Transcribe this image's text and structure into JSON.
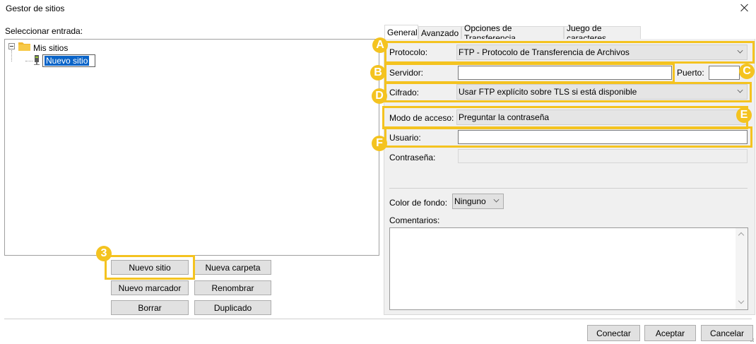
{
  "window": {
    "title": "Gestor de sitios"
  },
  "left": {
    "select_label": "Seleccionar entrada:",
    "tree": {
      "root": "Mis sitios",
      "child_editing": "Nuevo sitio"
    },
    "buttons": {
      "new_site": "Nuevo sitio",
      "new_folder": "Nueva carpeta",
      "new_bookmark": "Nuevo marcador",
      "rename": "Renombrar",
      "delete": "Borrar",
      "duplicate": "Duplicado"
    }
  },
  "tabs": [
    "General",
    "Avanzado",
    "Opciones de Transferencia",
    "Juego de caracteres"
  ],
  "general": {
    "protocol_label": "Protocolo:",
    "protocol_value": "FTP - Protocolo de Transferencia de Archivos",
    "server_label": "Servidor:",
    "server_value": "",
    "port_label": "Puerto:",
    "port_value": "",
    "encryption_label": "Cifrado:",
    "encryption_value": "Usar FTP explícito sobre TLS si está disponible",
    "logon_label": "Modo de acceso:",
    "logon_value": "Preguntar la contraseña",
    "user_label": "Usuario:",
    "user_value": "",
    "password_label": "Contraseña:",
    "bgcolor_label": "Color de fondo:",
    "bgcolor_value": "Ninguno",
    "comments_label": "Comentarios:",
    "comments_value": ""
  },
  "callouts": {
    "a": "A",
    "b": "B",
    "c": "C",
    "d": "D",
    "e": "E",
    "f": "F",
    "three": "3"
  },
  "footer": {
    "connect": "Conectar",
    "accept": "Aceptar",
    "cancel": "Cancelar"
  },
  "colors": {
    "highlight": "#f4c320",
    "selection": "#0a64c8"
  }
}
